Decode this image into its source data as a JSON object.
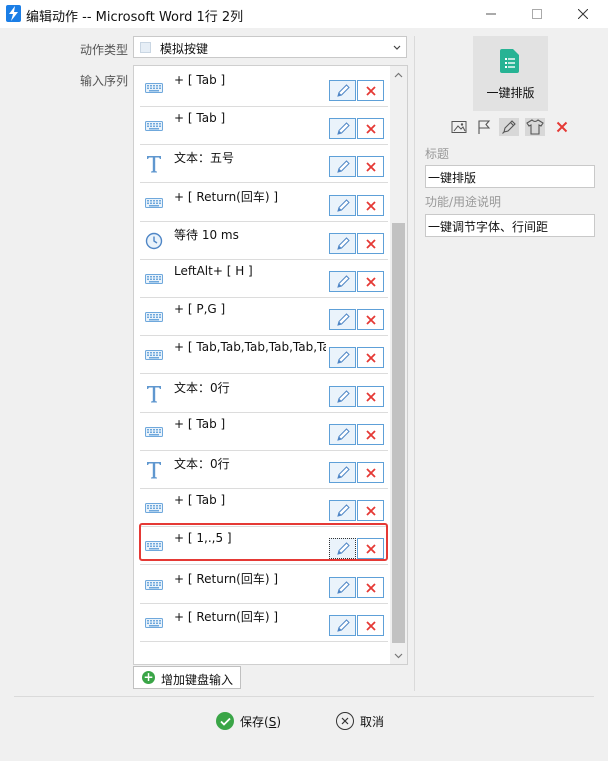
{
  "window": {
    "title": "编辑动作 -- Microsoft Word 1行 2列",
    "controls": {
      "minimize": "—",
      "maximize": "☐",
      "close": "✕"
    }
  },
  "form": {
    "action_type_label": "动作类型",
    "action_type_value": "模拟按键",
    "input_sequence_label": "输入序列"
  },
  "sequence": [
    {
      "icon": "keyboard-icon",
      "text": "+ [ Tab ]"
    },
    {
      "icon": "keyboard-icon",
      "text": "+ [ Tab ]"
    },
    {
      "icon": "text-t-icon",
      "text": "文本：五号"
    },
    {
      "icon": "keyboard-icon",
      "text": "+ [ Return(回车) ]"
    },
    {
      "icon": "clock-icon",
      "text": "等待 10 ms"
    },
    {
      "icon": "keyboard-icon",
      "text": "LeftAlt+ [ H ]"
    },
    {
      "icon": "keyboard-icon",
      "text": "+ [ P,G ]"
    },
    {
      "icon": "keyboard-icon",
      "text": "+ [ Tab,Tab,Tab,Tab,Tab,Tab,Tab,Tab ]"
    },
    {
      "icon": "text-t-icon",
      "text": "文本：0行"
    },
    {
      "icon": "keyboard-icon",
      "text": "+ [ Tab ]"
    },
    {
      "icon": "text-t-icon",
      "text": "文本：0行"
    },
    {
      "icon": "keyboard-icon",
      "text": "+ [ Tab ]"
    },
    {
      "icon": "keyboard-icon",
      "text": "+ [ 1,.,5 ]",
      "selected": true
    },
    {
      "icon": "keyboard-icon",
      "text": "+ [ Return(回车) ]"
    },
    {
      "icon": "keyboard-icon",
      "text": "+ [ Return(回车) ]"
    }
  ],
  "add_button_label": "增加键盘输入",
  "side": {
    "card_name": "一键排版",
    "title_label": "标题",
    "title_value": "一键排版",
    "desc_label": "功能/用途说明",
    "desc_value": "一键调节字体、行间距"
  },
  "footer": {
    "save_text": "保存(",
    "save_key": "S",
    "save_close": ")",
    "cancel": "取消"
  },
  "colors": {
    "accent": "#1b7ee6",
    "highlight": "#e53935",
    "delete": "#e53935",
    "green": "#3aa547"
  }
}
